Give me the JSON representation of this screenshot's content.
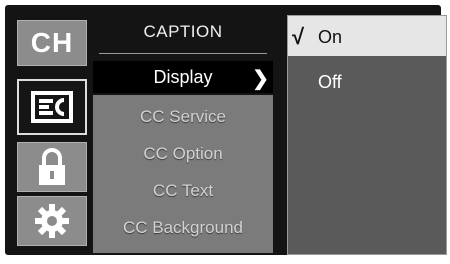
{
  "icons": {
    "channel": {
      "label": "CH",
      "icon": "channel-icon"
    },
    "caption": {
      "icon": "closed-caption-icon"
    },
    "lock": {
      "icon": "lock-icon"
    },
    "setup": {
      "icon": "gear-icon"
    }
  },
  "menu": {
    "title": "CAPTION",
    "selected": {
      "label": "Display",
      "icon": "chevron-right-icon"
    },
    "items": [
      {
        "label": "CC Service"
      },
      {
        "label": "CC Option"
      },
      {
        "label": "CC Text"
      },
      {
        "label": "CC Background"
      }
    ]
  },
  "options": {
    "items": [
      {
        "label": "On",
        "checked": true,
        "check_glyph": "√"
      },
      {
        "label": "Off",
        "checked": false
      }
    ]
  },
  "colors": {
    "osd_background": "#141414",
    "tile": "#8c8c8c",
    "menu_list": "#7b7b7b",
    "option_panel": "#5a5a5a",
    "option_highlight": "#e6e6e6"
  }
}
